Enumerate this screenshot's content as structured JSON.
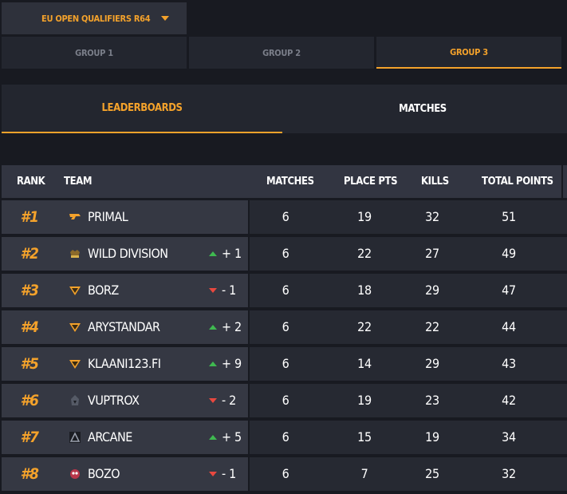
{
  "tournament": {
    "label": "EU OPEN QUALIFIERS R64"
  },
  "groups": [
    {
      "label": "GROUP 1",
      "active": false
    },
    {
      "label": "GROUP 2",
      "active": false
    },
    {
      "label": "GROUP 3",
      "active": true
    }
  ],
  "subtabs": [
    {
      "label": "LEADERBOARDS",
      "active": true
    },
    {
      "label": "MATCHES",
      "active": false
    }
  ],
  "colors": {
    "accent": "#f4a22b",
    "up": "#3fb950",
    "down": "#e8483f"
  },
  "table": {
    "headers": {
      "rank": "RANK",
      "team": "TEAM",
      "matches": "MATCHES",
      "place_pts": "PLACE PTS",
      "kills": "KILLS",
      "total_points": "TOTAL POINTS"
    },
    "rows": [
      {
        "rank": "#1",
        "team": "PRIMAL",
        "logo": "primal-logo",
        "change": "",
        "direction": "",
        "matches": "6",
        "place_pts": "19",
        "kills": "32",
        "total": "51"
      },
      {
        "rank": "#2",
        "team": "WILD DIVISION",
        "logo": "wild-division-logo",
        "change": "+ 1",
        "direction": "up",
        "matches": "6",
        "place_pts": "22",
        "kills": "27",
        "total": "49"
      },
      {
        "rank": "#3",
        "team": "BORZ",
        "logo": "borz-logo",
        "change": "- 1",
        "direction": "down",
        "matches": "6",
        "place_pts": "18",
        "kills": "29",
        "total": "47"
      },
      {
        "rank": "#4",
        "team": "ARYSTANDAR",
        "logo": "arystandar-logo",
        "change": "+ 2",
        "direction": "up",
        "matches": "6",
        "place_pts": "22",
        "kills": "22",
        "total": "44"
      },
      {
        "rank": "#5",
        "team": "KLAANI123.FI",
        "logo": "klaani-logo",
        "change": "+ 9",
        "direction": "up",
        "matches": "6",
        "place_pts": "14",
        "kills": "29",
        "total": "43"
      },
      {
        "rank": "#6",
        "team": "VUPTROX",
        "logo": "vuptrox-logo",
        "change": "- 2",
        "direction": "down",
        "matches": "6",
        "place_pts": "19",
        "kills": "23",
        "total": "42"
      },
      {
        "rank": "#7",
        "team": "ARCANE",
        "logo": "arcane-logo",
        "change": "+ 5",
        "direction": "up",
        "matches": "6",
        "place_pts": "15",
        "kills": "19",
        "total": "34"
      },
      {
        "rank": "#8",
        "team": "BOZO",
        "logo": "bozo-logo",
        "change": "- 1",
        "direction": "down",
        "matches": "6",
        "place_pts": "7",
        "kills": "25",
        "total": "32"
      }
    ]
  }
}
